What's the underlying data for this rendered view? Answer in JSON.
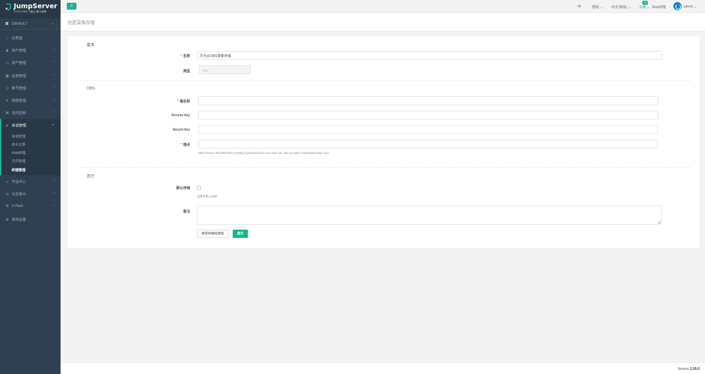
{
  "brand": {
    "name": "JumpServer",
    "subtitle": "FIT2CLOUD 飞致云 旗下品牌",
    "accent_color": "#1ab394",
    "sidebar_color": "#2f4050"
  },
  "org": {
    "label": "DEFAULT",
    "icon": "bookmark-icon"
  },
  "nav": [
    {
      "label": "仪表盘",
      "icon": "dashboard-icon",
      "has_children": false
    },
    {
      "label": "用户管理",
      "icon": "users-icon",
      "has_children": true
    },
    {
      "label": "资产管理",
      "icon": "inbox-icon",
      "has_children": true
    },
    {
      "label": "应用管理",
      "icon": "apps-icon",
      "has_children": true
    },
    {
      "label": "账号管理",
      "icon": "account-icon",
      "has_children": true
    },
    {
      "label": "权限管理",
      "icon": "edit-icon",
      "has_children": true
    },
    {
      "label": "访问控制",
      "icon": "sitemap-icon",
      "has_children": true
    },
    {
      "label": "会话管理",
      "icon": "rocket-icon",
      "has_children": true,
      "active": true
    }
  ],
  "session_sub": [
    {
      "label": "会话管理",
      "active": false
    },
    {
      "label": "命令记录",
      "active": false
    },
    {
      "label": "Web终端",
      "active": false
    },
    {
      "label": "文件管理",
      "active": false
    },
    {
      "label": "终端管理",
      "active": true
    }
  ],
  "nav_after": [
    {
      "label": "作业中心",
      "icon": "coffee-icon",
      "has_children": true
    },
    {
      "label": "日志审计",
      "icon": "history-icon",
      "has_children": true
    },
    {
      "label": "X-Pack",
      "icon": "sliders-icon",
      "has_children": true
    },
    {
      "label": "系统设置",
      "icon": "gears-icon",
      "has_children": false
    }
  ],
  "topbar": {
    "menu_icon": "hamburger-icon",
    "mail_icon": "envelope-icon",
    "help": "帮助",
    "language": "中文(简体)",
    "tickets": "工单",
    "tickets_badge": "10",
    "web_terminal": "Web终端",
    "user": "admin"
  },
  "page": {
    "title": "创建录像存储"
  },
  "form": {
    "section_basic": "基本",
    "name_label": "名称",
    "name_value": "华为云OBS录像存储",
    "type_label": "类型",
    "type_value": "OBS",
    "section_obs": "OBS",
    "bucket_label": "桶名称",
    "access_key_label": "Access key",
    "secret_key_label": "Secret key",
    "endpoint_label": "端点",
    "endpoint_help": "OBS format: obs.{REGION_NAME}.myhuaweicloud.com Such as: obs.cn-north-4.myhuaweicloud.com",
    "section_other": "其它",
    "default_label": "默认存储",
    "default_help": "设置为默认存储",
    "comment_label": "备注",
    "save_continue": "保存并继续添加",
    "submit": "提交"
  },
  "footer": {
    "version_label": "Version",
    "version": "2.16.0"
  }
}
